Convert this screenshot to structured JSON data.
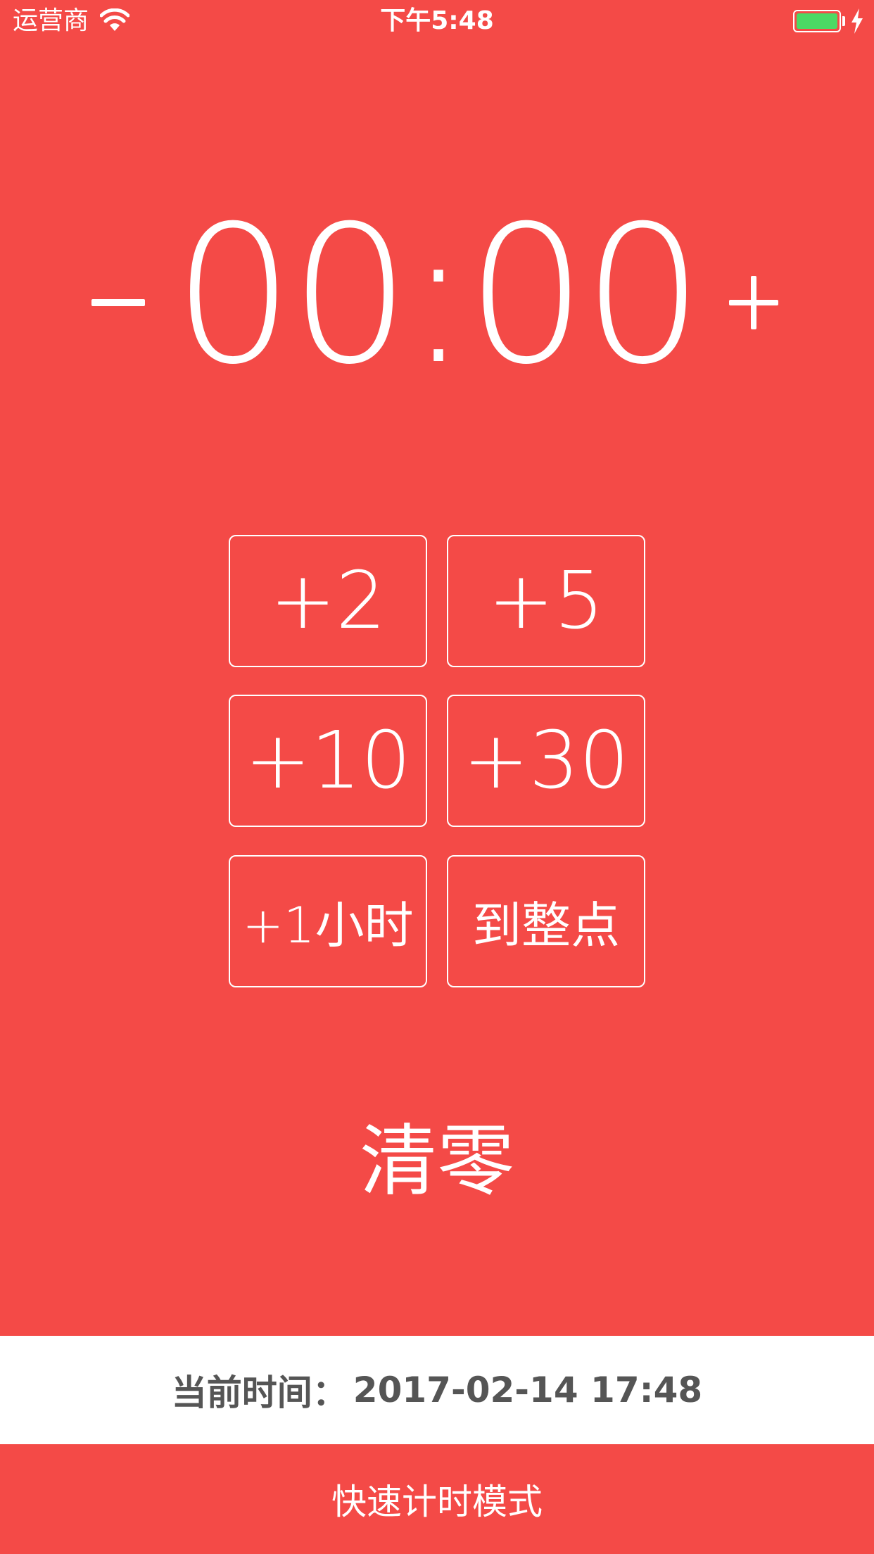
{
  "status_bar": {
    "carrier": "运营商",
    "time": "下午5:48",
    "battery_color": "#4cd964",
    "icons": [
      "wifi-icon",
      "battery-icon",
      "charging-bolt-icon"
    ]
  },
  "timer": {
    "minus_label": "−",
    "display": "00:00",
    "plus_label": "+"
  },
  "quick_buttons": [
    {
      "label": "+2"
    },
    {
      "label": "+5"
    },
    {
      "label": "+10"
    },
    {
      "label": "+30"
    },
    {
      "label": "+1小时"
    },
    {
      "label": "到整点"
    }
  ],
  "clear_label": "清零",
  "current_time": {
    "label": "当前时间：",
    "value": "2017-02-14 17:48"
  },
  "mode_bar": {
    "label": "快速计时模式"
  },
  "colors": {
    "background": "#f44a47",
    "text": "#ffffff",
    "info_text": "#555555"
  }
}
